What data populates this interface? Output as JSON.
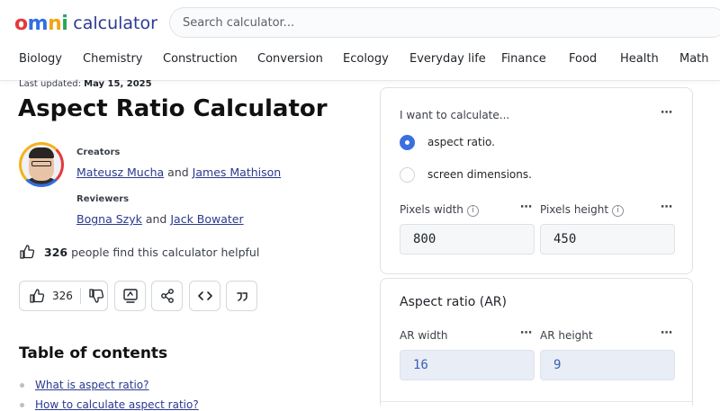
{
  "logo": {
    "omni": [
      "o",
      "m",
      "n",
      "i"
    ],
    "calculator": "calculator"
  },
  "search": {
    "placeholder": "Search calculator..."
  },
  "nav": [
    "Biology",
    "Chemistry",
    "Construction",
    "Conversion",
    "Ecology",
    "Everyday life",
    "Finance",
    "Food",
    "Health",
    "Math"
  ],
  "article": {
    "updated_label": "Last updated:",
    "updated_date": "May 15, 2025",
    "title": "Aspect Ratio Calculator",
    "creators_label": "Creators",
    "creator1": "Mateusz Mucha",
    "and1": "and",
    "creator2": "James Mathison",
    "reviewers_label": "Reviewers",
    "reviewer1": "Bogna Szyk",
    "and2": "and",
    "reviewer2": "Jack Bowater",
    "helpful_count": "326",
    "helpful_text": "people find this calculator helpful",
    "like_count": "326"
  },
  "toc": {
    "title": "Table of contents",
    "items": [
      "What is aspect ratio?",
      "How to calculate aspect ratio?"
    ]
  },
  "calculator": {
    "want_label": "I want to calculate...",
    "option1": "aspect ratio.",
    "option2": "screen dimensions.",
    "selected": "aspect ratio.",
    "pixels_width_label": "Pixels width",
    "pixels_height_label": "Pixels height",
    "pixels_width": "800",
    "pixels_height": "450",
    "section_title": "Aspect ratio (AR)",
    "ar_width_label": "AR width",
    "ar_height_label": "AR height",
    "ar_width": "16",
    "ar_height": "9"
  },
  "colors": {
    "accent": "#3b6fe0",
    "link": "#2a3a8f",
    "calc_field_bg": "#e8edf6",
    "calc_field_text": "#3b5fb0"
  }
}
